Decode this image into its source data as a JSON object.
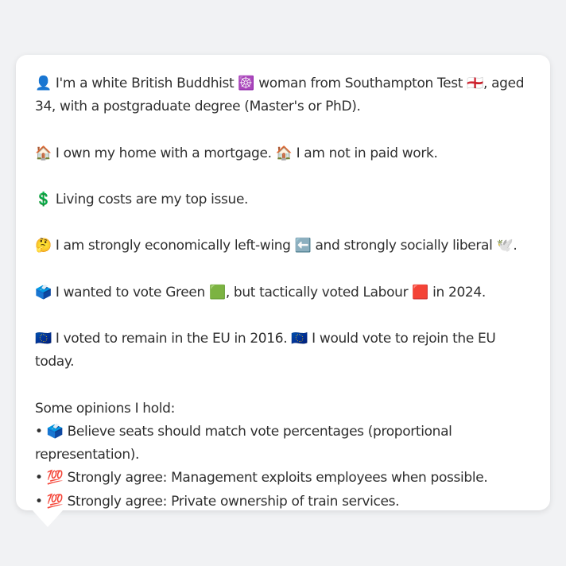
{
  "profile": {
    "line1": "👤 I'm a white British Buddhist ☸️ woman from Southampton Test 🏴󠁧󠁢󠁥󠁮󠁧󠁿, aged 34, with a postgraduate degree (Master's or PhD).",
    "line2": "🏠 I own my home with a mortgage. 🏠 I am not in paid work.",
    "line3": "💲 Living costs are my top issue.",
    "line4": "🤔 I am strongly economically left-wing ⬅️ and strongly socially liberal 🕊️.",
    "line5": "🗳️ I wanted to vote Green 🟩, but tactically voted Labour 🟥 in 2024.",
    "line6": "🇪🇺 I voted to remain in the EU in 2016. 🇪🇺 I would vote to rejoin the EU today."
  },
  "opinions": {
    "heading": "Some opinions I hold:",
    "items": [
      "• 🗳️ Believe seats should match vote percentages (proportional representation).",
      "• 💯 Strongly agree: Management exploits employees when possible.",
      "• 💯 Strongly agree: Private ownership of train services."
    ]
  }
}
